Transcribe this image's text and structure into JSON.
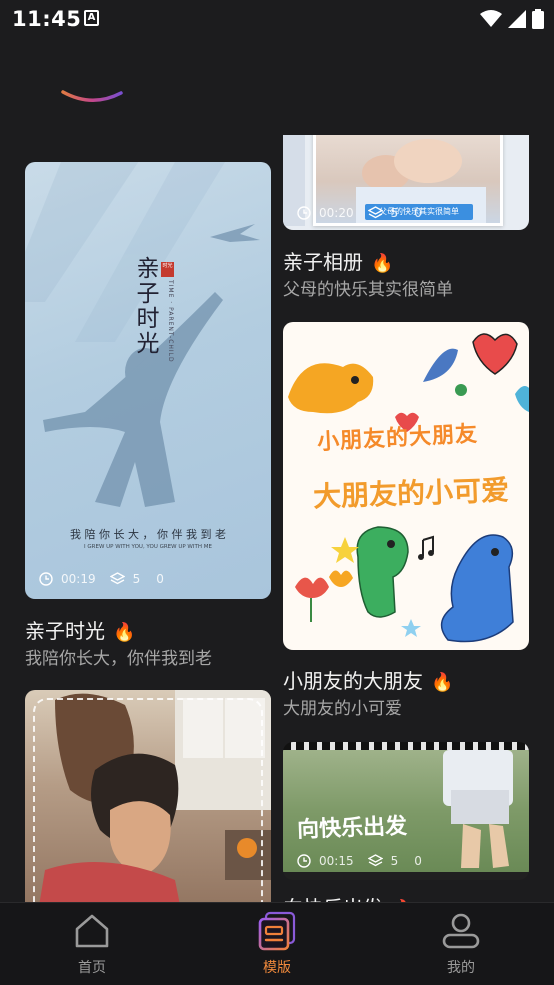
{
  "status_bar": {
    "time": "11:45",
    "badge": "A"
  },
  "colors": {
    "background": "#1c1c1e",
    "accent": "#f08a3c",
    "flame": "#ff6a1a",
    "muted": "#a7a7a7"
  },
  "cards": [
    {
      "id": "qinzi-shiguang",
      "title": "亲子时光",
      "subtitle": "我陪你长大，你伴我到老",
      "hot_icon": "flame-icon",
      "duration": "00:19",
      "layers": "5",
      "count": "0",
      "poster": {
        "headline": "亲子时光",
        "seal": "时光",
        "vertical_en": "TIME · PARENT-CHILD",
        "caption": "我 陪 你 长 大 ， 你 伴 我 到 老",
        "caption_en": "I GREW UP WITH YOU, YOU GREW UP WITH ME"
      }
    },
    {
      "id": "qinzi-xiangce",
      "title": "亲子相册",
      "subtitle": "父母的快乐其实很简单",
      "hot_icon": "flame-icon",
      "duration": "00:20",
      "layers": "5",
      "count": "0",
      "poster": {
        "banner": "父母的快乐其实很简单"
      }
    },
    {
      "id": "xiaopengyou",
      "title": "小朋友的大朋友",
      "subtitle": "大朋友的小可爱",
      "hot_icon": "flame-icon",
      "poster": {
        "line1": "小朋友的大朋友",
        "line2": "大朋友的小可爱"
      }
    },
    {
      "id": "xiang-kuaile",
      "title": "向快乐出发",
      "hot_icon": "flame-icon",
      "duration": "00:15",
      "layers": "5",
      "count": "0",
      "poster": {
        "headline": "向快乐出发"
      }
    },
    {
      "id": "family-photo",
      "hot_icon": "flame-icon"
    }
  ],
  "bottom_nav": {
    "items": [
      {
        "label": "首页",
        "icon": "home-icon",
        "active": false
      },
      {
        "label": "模版",
        "icon": "template-icon",
        "active": true
      },
      {
        "label": "我的",
        "icon": "profile-icon",
        "active": false
      }
    ]
  }
}
